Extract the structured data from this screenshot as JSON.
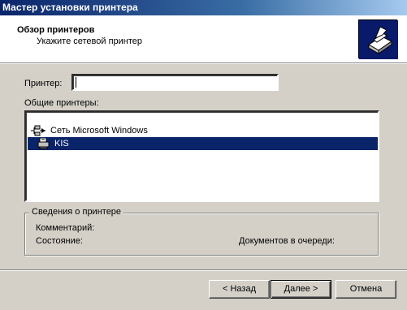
{
  "window": {
    "title": "Мастер установки принтера"
  },
  "header": {
    "title": "Обзор принтеров",
    "subtitle": "Укажите сетевой принтер",
    "icon": "printer-wizard-icon"
  },
  "printer_field": {
    "label": "Принтер:",
    "value": ""
  },
  "shared": {
    "label": "Общие принтеры:",
    "tree": [
      {
        "label": "Сеть Microsoft Windows",
        "icon": "network-icon",
        "selected": false
      },
      {
        "label": "KIS",
        "icon": "printer-server-icon",
        "selected": true
      }
    ]
  },
  "info": {
    "title": "Сведения о принтере",
    "comment_label": "Комментарий:",
    "state_label": "Состояние:",
    "queue_label": "Документов в очереди:"
  },
  "buttons": {
    "back": "< Назад",
    "next": "Далее >",
    "cancel": "Отмена"
  },
  "colors": {
    "title_start": "#0a246a",
    "title_end": "#a6caf0",
    "selection": "#0a246a",
    "face": "#d4d0c8"
  }
}
